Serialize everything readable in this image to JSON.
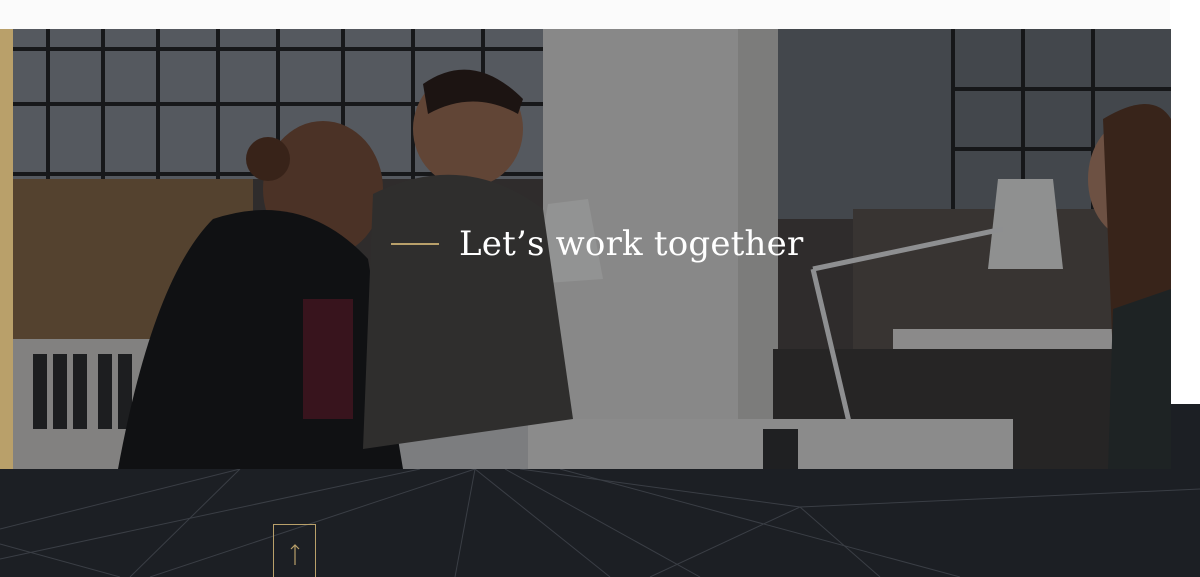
{
  "hero": {
    "heading": "Let’s work together",
    "image_description_icon": "office-team-photo"
  },
  "footer": {
    "back_to_top_icon": "arrow-up-icon"
  },
  "colors": {
    "accent": "#b9a06a",
    "footer_bg": "#1c1f24",
    "heading_text": "#ffffff",
    "top_strip": "#fbfbfb"
  }
}
